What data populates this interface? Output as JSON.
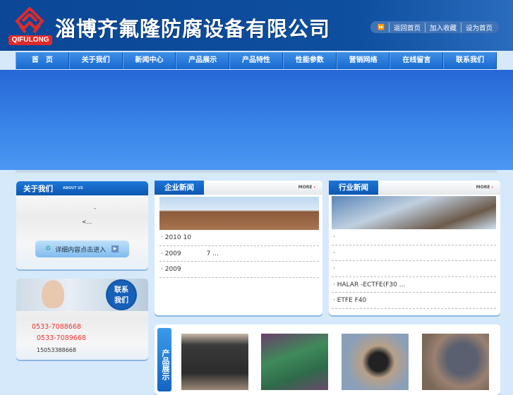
{
  "header": {
    "logo_text": "QIFULONG",
    "company": "淄博齐氟隆防腐设备有限公司",
    "links": [
      "返回首页",
      "加入收藏",
      "设为首页"
    ]
  },
  "nav": [
    "首　页",
    "关于我们",
    "新闻中心",
    "产品展示",
    "产品特性",
    "性能参数",
    "营销网络",
    "在线留言",
    "联系我们"
  ],
  "about": {
    "title": "关于我们",
    "subtitle": "ABOUT US",
    "line1": "-",
    "line2": "<...",
    "button": "详细内容点击进入"
  },
  "contact": {
    "badge": "联系我们",
    "phones": [
      "0533-7088668",
      "0533-7089668",
      "15053388668"
    ]
  },
  "company_news": {
    "title": "企业新闻",
    "more": "MORE",
    "items": [
      "2010 10",
      "2009　　　　7 ...",
      "2009"
    ]
  },
  "industry_news": {
    "title": "行业新闻",
    "more": "MORE",
    "items": [
      "",
      "",
      "",
      "HALAR -ECTFE(F30 ...",
      "ETFE  F40"
    ]
  },
  "products": {
    "title": "产品展示"
  }
}
